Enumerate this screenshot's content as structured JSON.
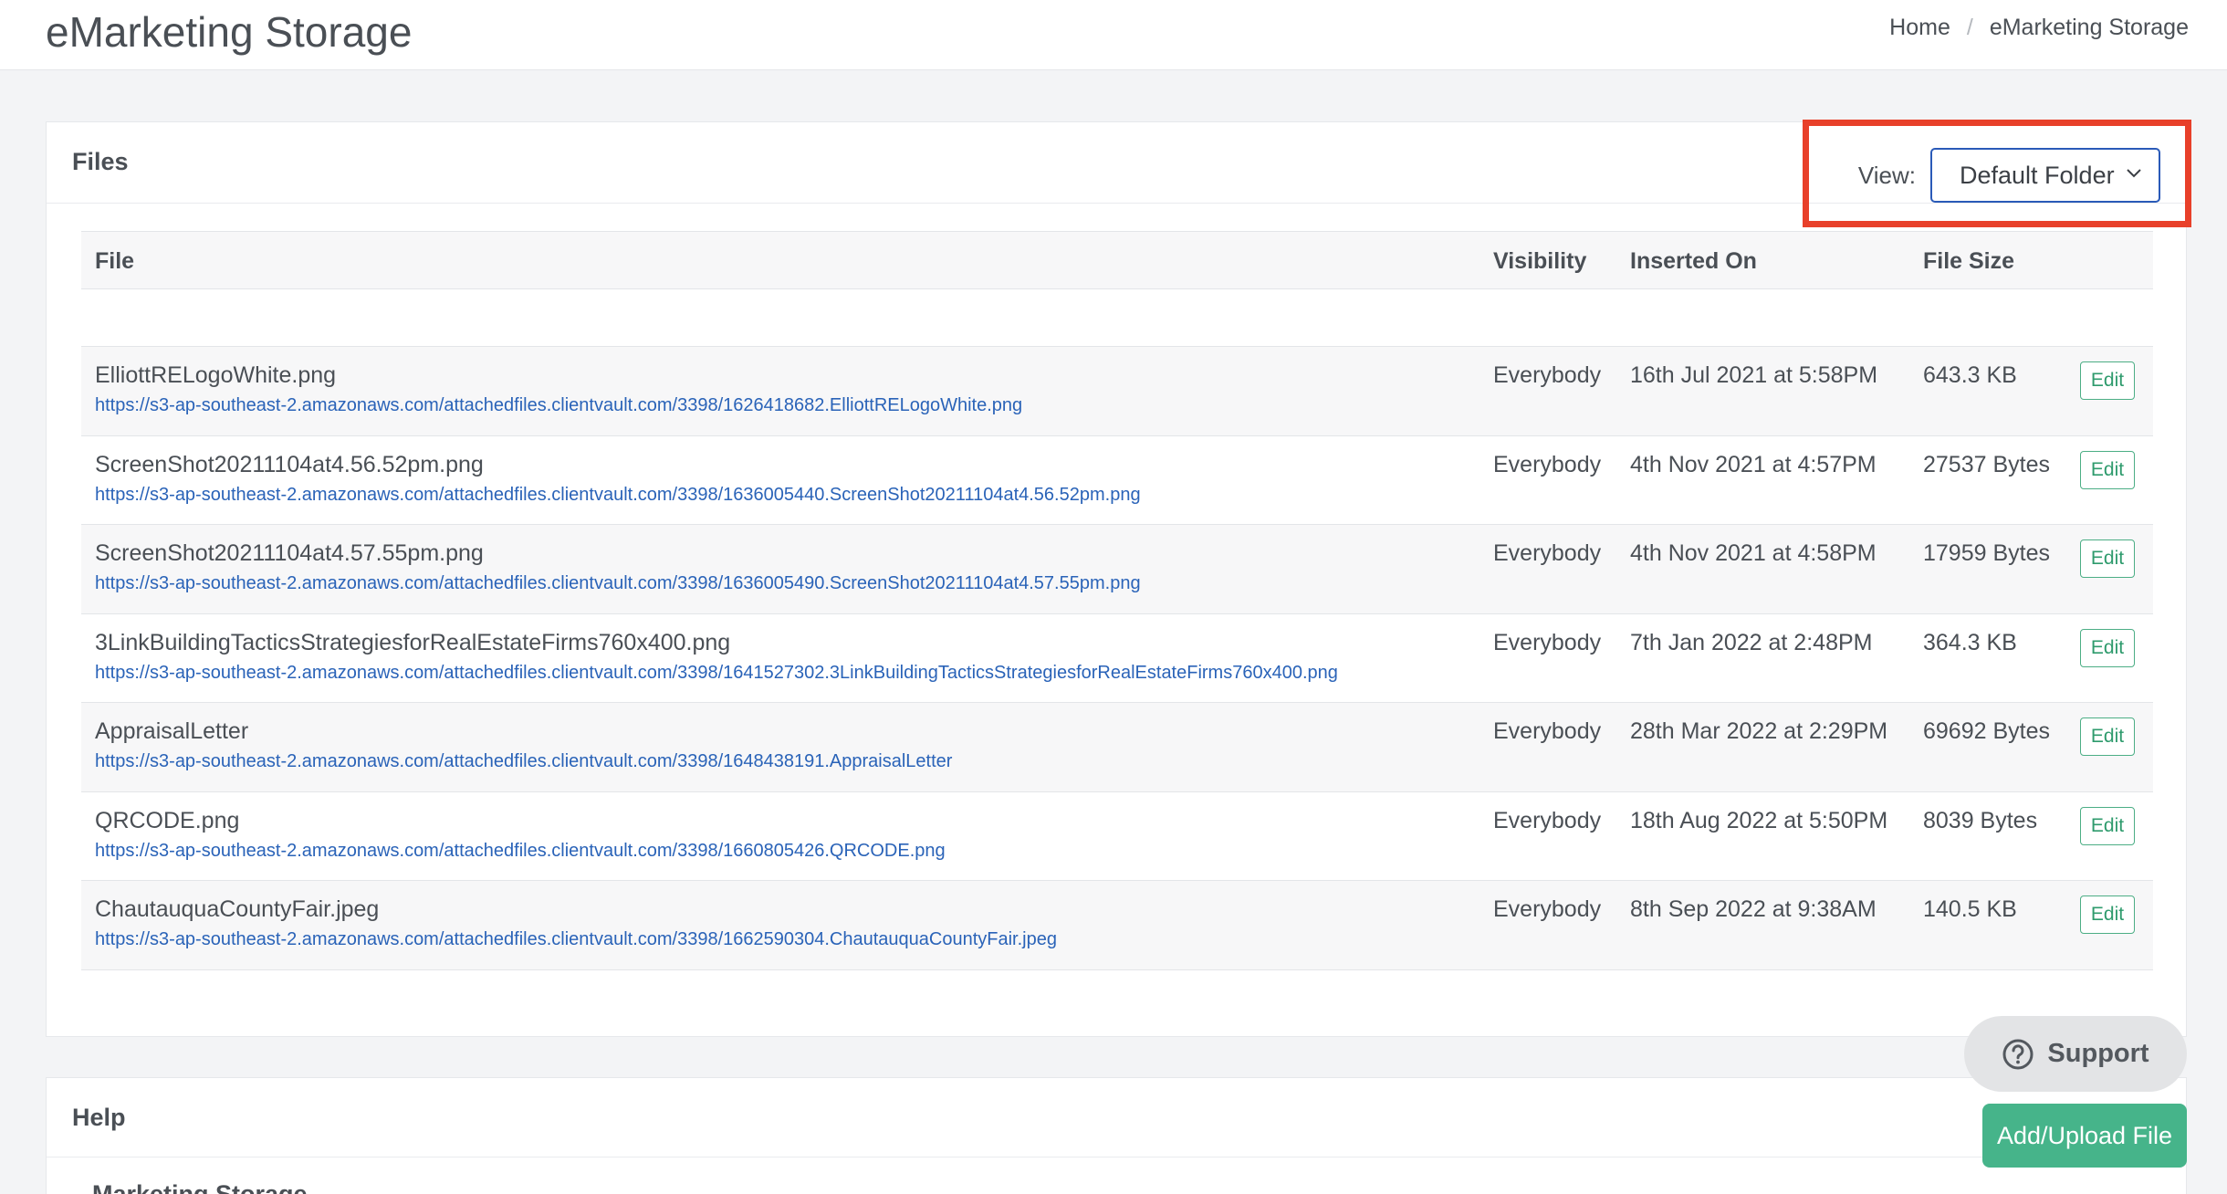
{
  "header": {
    "title": "eMarketing Storage",
    "breadcrumb": [
      "Home",
      "eMarketing Storage"
    ],
    "breadcrumb_sep": "/"
  },
  "files": {
    "title": "Files",
    "view_label": "View:",
    "view_selected": "Default Folder",
    "columns": [
      "File",
      "Visibility",
      "Inserted On",
      "File Size"
    ],
    "edit_label": "Edit",
    "rows": [
      {
        "name": "ElliottRELogoWhite.png",
        "url": "https://s3-ap-southeast-2.amazonaws.com/attachedfiles.clientvault.com/3398/1626418682.ElliottRELogoWhite.png",
        "visibility": "Everybody",
        "inserted": "16th Jul 2021 at 5:58PM",
        "size": "643.3 KB"
      },
      {
        "name": "ScreenShot20211104at4.56.52pm.png",
        "url": "https://s3-ap-southeast-2.amazonaws.com/attachedfiles.clientvault.com/3398/1636005440.ScreenShot20211104at4.56.52pm.png",
        "visibility": "Everybody",
        "inserted": "4th Nov 2021 at 4:57PM",
        "size": "27537 Bytes"
      },
      {
        "name": "ScreenShot20211104at4.57.55pm.png",
        "url": "https://s3-ap-southeast-2.amazonaws.com/attachedfiles.clientvault.com/3398/1636005490.ScreenShot20211104at4.57.55pm.png",
        "visibility": "Everybody",
        "inserted": "4th Nov 2021 at 4:58PM",
        "size": "17959 Bytes"
      },
      {
        "name": "3LinkBuildingTacticsStrategiesforRealEstateFirms760x400.png",
        "url": "https://s3-ap-southeast-2.amazonaws.com/attachedfiles.clientvault.com/3398/1641527302.3LinkBuildingTacticsStrategiesforRealEstateFirms760x400.png",
        "visibility": "Everybody",
        "inserted": "7th Jan 2022 at 2:48PM",
        "size": "364.3 KB"
      },
      {
        "name": "AppraisalLetter",
        "url": "https://s3-ap-southeast-2.amazonaws.com/attachedfiles.clientvault.com/3398/1648438191.AppraisalLetter",
        "visibility": "Everybody",
        "inserted": "28th Mar 2022 at 2:29PM",
        "size": "69692 Bytes"
      },
      {
        "name": "QRCODE.png",
        "url": "https://s3-ap-southeast-2.amazonaws.com/attachedfiles.clientvault.com/3398/1660805426.QRCODE.png",
        "visibility": "Everybody",
        "inserted": "18th Aug 2022 at 5:50PM",
        "size": "8039 Bytes"
      },
      {
        "name": "ChautauquaCountyFair.jpeg",
        "url": "https://s3-ap-southeast-2.amazonaws.com/attachedfiles.clientvault.com/3398/1662590304.ChautauquaCountyFair.jpeg",
        "visibility": "Everybody",
        "inserted": "8th Sep 2022 at 9:38AM",
        "size": "140.5 KB"
      }
    ]
  },
  "help": {
    "title": "Help",
    "subtitle": "Marketing Storage"
  },
  "support": {
    "label": "Support",
    "icon": "question-circle-icon"
  },
  "upload": {
    "label": "Add/Upload File"
  },
  "colors": {
    "accent": "#2a5ab8",
    "highlight": "#e8402a",
    "success": "#46b48a",
    "link": "#2a63b8"
  }
}
